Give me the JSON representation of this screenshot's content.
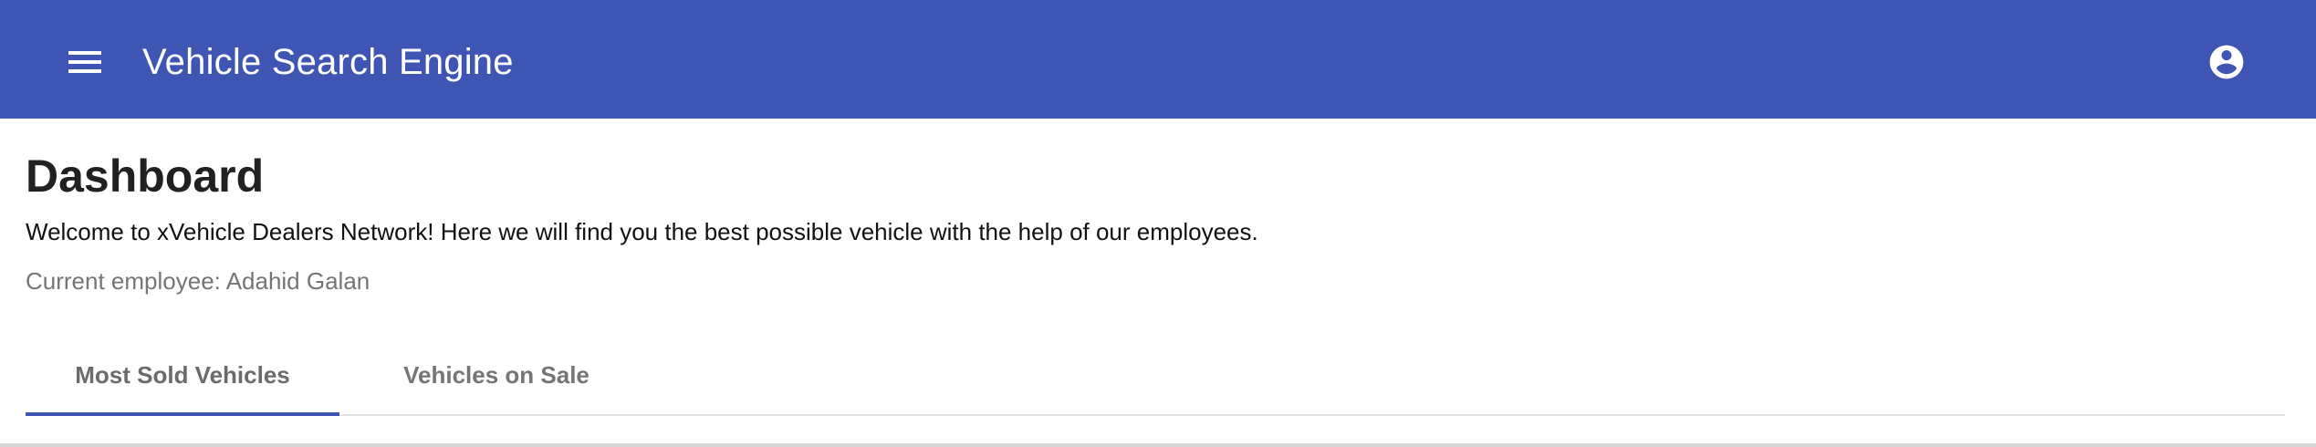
{
  "app": {
    "title": "Vehicle Search Engine"
  },
  "colors": {
    "appbar": "#3f55b4",
    "tab_indicator": "#3f55b4",
    "muted_text": "#757575"
  },
  "icons": {
    "menu": "menu-icon",
    "account": "account-circle-icon"
  },
  "dashboard": {
    "title": "Dashboard",
    "welcome": "Welcome to xVehicle Dealers Network! Here we will find you the best possible vehicle with the help of our employees.",
    "employee_label": "Current employee:",
    "employee_name": "Adahid Galan"
  },
  "tabs": [
    {
      "label": "Most Sold Vehicles",
      "active": true
    },
    {
      "label": "Vehicles on Sale",
      "active": false
    }
  ]
}
